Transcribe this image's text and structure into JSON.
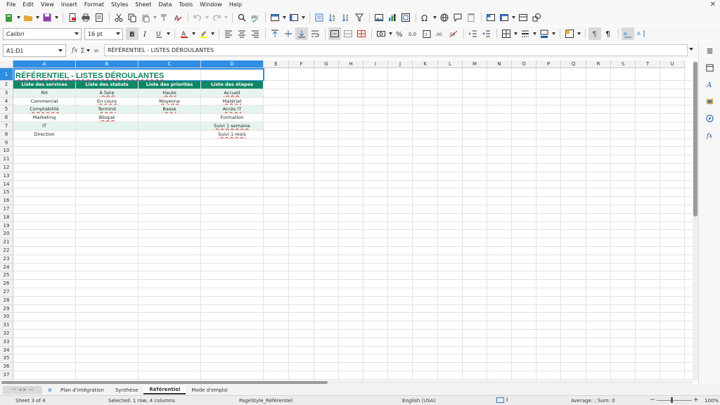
{
  "menu": [
    "File",
    "Edit",
    "View",
    "Insert",
    "Format",
    "Styles",
    "Sheet",
    "Data",
    "Tools",
    "Window",
    "Help"
  ],
  "window": {
    "close_label": "✕"
  },
  "toolbar": {
    "font_name": "Calibri",
    "font_size": "16 pt"
  },
  "formula_bar": {
    "name_box": "A1:D1",
    "content": "RÉFÉRENTIEL - LISTES DÉROULANTES"
  },
  "columns": [
    "A",
    "B",
    "C",
    "D",
    "E",
    "F",
    "G",
    "H",
    "I",
    "J",
    "K",
    "L",
    "M",
    "N",
    "O",
    "P",
    "Q",
    "R",
    "S",
    "T",
    "U"
  ],
  "rows": [
    "1",
    "2",
    "3",
    "4",
    "5",
    "6",
    "7",
    "8",
    "9",
    "10",
    "11",
    "12",
    "13",
    "14",
    "15",
    "16",
    "17",
    "18",
    "19",
    "20",
    "21",
    "22",
    "23",
    "24",
    "25",
    "26",
    "27",
    "28",
    "29",
    "30",
    "31",
    "32",
    "33",
    "34",
    "35",
    "36",
    "37"
  ],
  "sheet": {
    "title": "RÉFÉRENTIEL - LISTES DÉROULANTES",
    "headers": [
      "Liste des services",
      "Liste des statuts",
      "Liste des priorités",
      "Liste des étapes"
    ],
    "data": [
      [
        "RH",
        "À faire",
        "Haute",
        "Accueil"
      ],
      [
        "Commercial",
        "En cours",
        "Moyenne",
        "Matériel"
      ],
      [
        "Comptabilité",
        "Terminé",
        "Basse",
        "Accès IT"
      ],
      [
        "Marketing",
        "Bloqué",
        "",
        "Formation"
      ],
      [
        "IT",
        "",
        "",
        "Suivi 1 semaine"
      ],
      [
        "Direction",
        "",
        "",
        "Suivi 1 mois"
      ]
    ]
  },
  "tabs": {
    "nav_label": "⏮ ◀ ▶ ⏭",
    "add_label": "⊕",
    "items": [
      "Plan d'intégration",
      "Synthèse",
      "Référentiel",
      "Mode d'emploi"
    ],
    "active": "Référentiel"
  },
  "status": {
    "sheet": "Sheet 3 of 4",
    "selection": "Selected: 1 row, 4 columns",
    "page_style": "PageStyle_Référentiel",
    "language": "English (USA)",
    "sum": "Average: ; Sum: 0",
    "zoom": "100%"
  }
}
